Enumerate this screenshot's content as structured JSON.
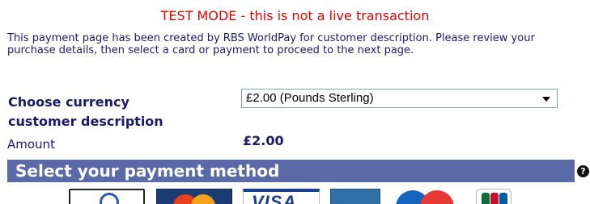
{
  "banner": {
    "test_mode": "TEST MODE - this is not a live transaction"
  },
  "intro": {
    "text": "This payment page has been created by RBS WorldPay for customer description. Please review your purchase details, then select a card or payment to proceed to the next page."
  },
  "currency": {
    "label_line1": "Choose currency",
    "label_line2": "customer description",
    "selected": "£2.00 (Pounds Sterling)"
  },
  "amount": {
    "label": "Amount",
    "value": "£2.00"
  },
  "payment_method": {
    "header": "Select your payment method",
    "help_glyph": "?",
    "cards": [
      "diners-club-card-icon",
      "mastercard-icon",
      "visa-icon",
      "visa-electron-icon",
      "maestro-icon",
      "jcb-icon"
    ]
  },
  "colors": {
    "test_mode_red": "#e60000",
    "text_navy": "#1a1a6a",
    "header_bar": "#5a6aa7"
  }
}
